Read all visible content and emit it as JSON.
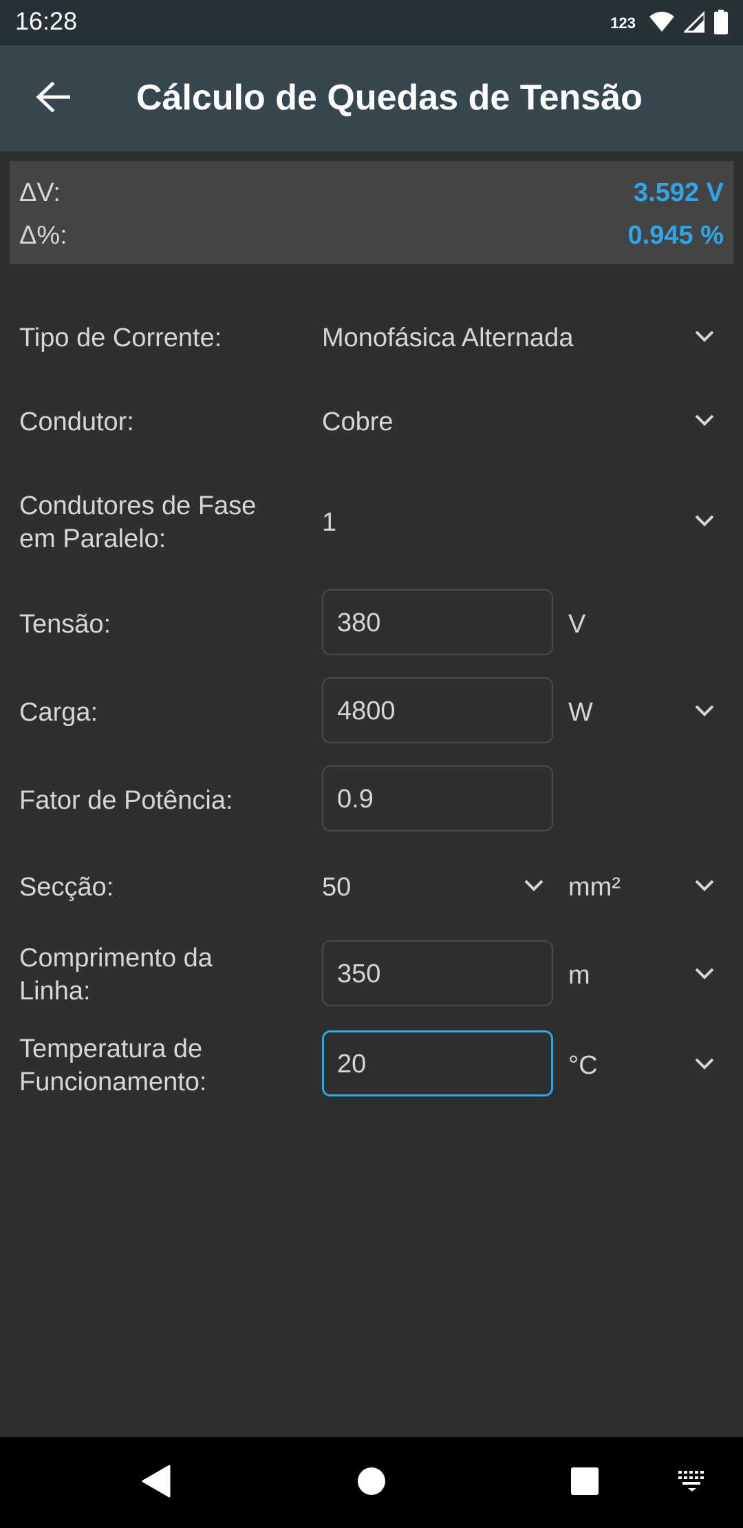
{
  "status_bar": {
    "time": "16:28",
    "indicator": "123",
    "icons": [
      "wifi-icon",
      "signal-icon",
      "battery-icon"
    ]
  },
  "app_bar": {
    "title": "Cálculo de Quedas de Tensão",
    "back_icon": "arrow-back-icon"
  },
  "results": {
    "delta_v": {
      "label": "ΔV:",
      "value": "3.592 V"
    },
    "delta_percent": {
      "label": "Δ%:",
      "value": "0.945 %"
    }
  },
  "form": {
    "tipo_corrente": {
      "label": "Tipo de Corrente:",
      "value": "Monofásica Alternada"
    },
    "condutor": {
      "label": "Condutor:",
      "value": "Cobre"
    },
    "condutores_paralelo": {
      "label_line1": "Condutores de Fase",
      "label_line2": "em Paralelo:",
      "value": "1"
    },
    "tensao": {
      "label": "Tensão:",
      "value": "380",
      "unit": "V"
    },
    "carga": {
      "label": "Carga:",
      "value": "4800",
      "unit": "W"
    },
    "fator_potencia": {
      "label": "Fator de Potência:",
      "value": "0.9"
    },
    "seccao": {
      "label": "Secção:",
      "value": "50",
      "unit": "mm²"
    },
    "comprimento": {
      "label_line1": "Comprimento da",
      "label_line2": "Linha:",
      "value": "350",
      "unit": "m"
    },
    "temperatura": {
      "label_line1": "Temperatura de",
      "label_line2": "Funcionamento:",
      "value": "20",
      "unit": "°C"
    }
  },
  "colors": {
    "accent": "#2ea6ea",
    "app_bar": "#37474f",
    "status_bar": "#263238",
    "background": "#2f2f2f",
    "result_panel": "#444444"
  },
  "nav_bar": {
    "icons": [
      "back-triangle-icon",
      "home-circle-icon",
      "recents-square-icon",
      "keyboard-icon"
    ]
  }
}
